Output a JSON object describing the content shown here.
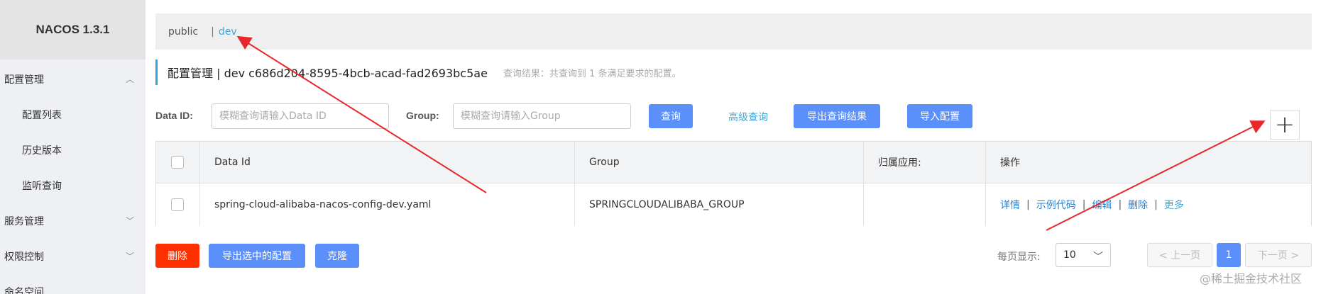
{
  "sidebar": {
    "logo": "NACOS 1.3.1",
    "items": [
      {
        "label": "配置管理"
      },
      {
        "label": "配置列表"
      },
      {
        "label": "历史版本"
      },
      {
        "label": "监听查询"
      },
      {
        "label": "服务管理"
      },
      {
        "label": "权限控制"
      },
      {
        "label": "命名空间"
      }
    ]
  },
  "namespace": {
    "public": "public",
    "separator": "|",
    "dev": "dev"
  },
  "title": {
    "main": "配置管理  |  dev  c686d204-8595-4bcb-acad-fad2693bc5ae",
    "result": "查询结果：共查询到 1 条满足要求的配置。"
  },
  "search": {
    "dataid_label": "Data ID:",
    "dataid_placeholder": "模糊查询请输入Data ID",
    "group_label": "Group:",
    "group_placeholder": "模糊查询请输入Group",
    "query_btn": "查询",
    "advanced_link": "高级查询",
    "export_btn": "导出查询结果",
    "import_btn": "导入配置",
    "add_icon": "+"
  },
  "table": {
    "headers": [
      "Data Id",
      "Group",
      "归属应用:",
      "操作"
    ],
    "rows": [
      {
        "data_id": "spring-cloud-alibaba-nacos-config-dev.yaml",
        "group": "SPRINGCLOUDALIBABA_GROUP",
        "app": "",
        "ops": {
          "detail": "详情",
          "sample": "示例代码",
          "edit": "编辑",
          "delete": "删除",
          "more": "更多",
          "sep": "|"
        }
      }
    ]
  },
  "footer": {
    "delete_btn": "删除",
    "export_selected_btn": "导出选中的配置",
    "clone_btn": "克隆",
    "page_size_label": "每页显示:",
    "page_size": "10",
    "prev": "< 上一页",
    "current_page": "1",
    "next": "下一页 >"
  },
  "watermark": "@稀土掘金技术社区",
  "colors": {
    "primary": "#5b8ff9",
    "danger": "#ff3000",
    "link": "#3ea8d8",
    "arrow": "#e8272b"
  }
}
